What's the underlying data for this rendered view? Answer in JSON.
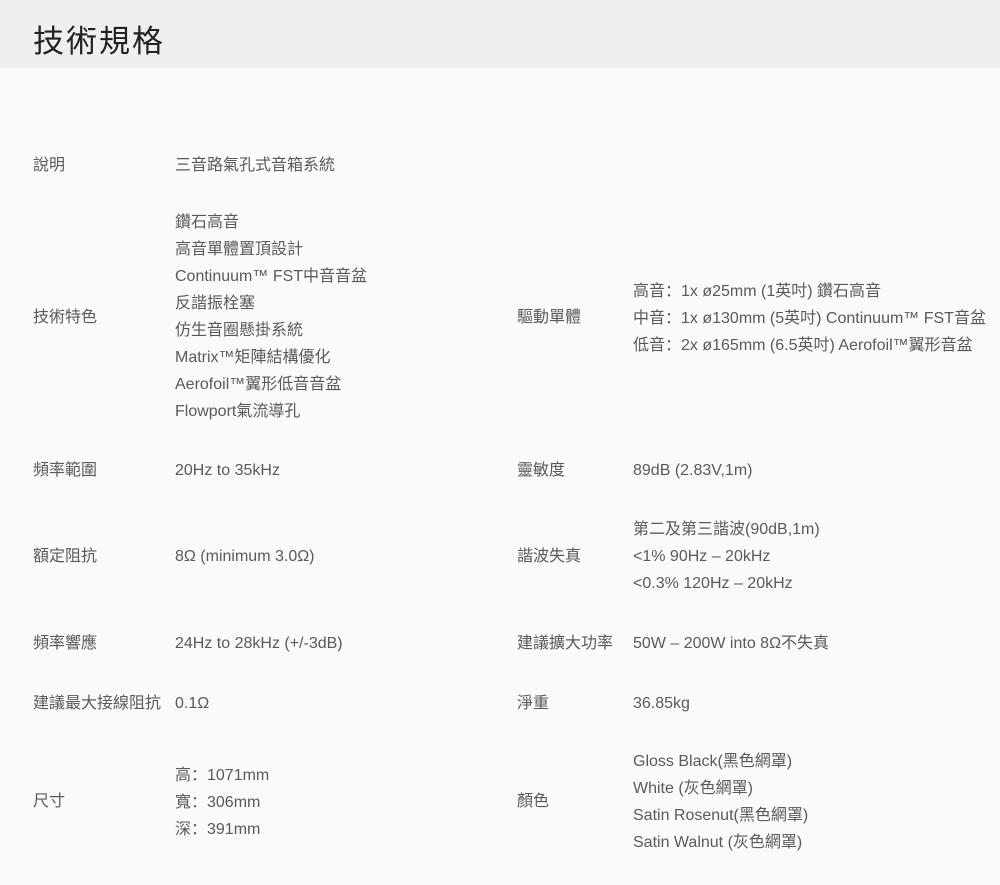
{
  "title": "技術規格",
  "specs": {
    "description": {
      "label": "說明",
      "value": "三音路氣孔式音箱系統"
    },
    "features": {
      "label": "技術特色",
      "lines": [
        "鑽石高音",
        "高音單體置頂設計",
        "Continuum™ FST中音音盆",
        "反諧振栓塞",
        "仿生音圈懸掛系統",
        "Matrix™矩陣結構優化",
        "Aerofoil™翼形低音音盆",
        "Flowport氣流導孔"
      ]
    },
    "drivers": {
      "label": "驅動單體",
      "lines": [
        "高音：1x ø25mm (1英吋) 鑽石高音",
        "中音：1x ø130mm (5英吋) Continuum™ FST音盆",
        "低音：2x ø165mm (6.5英吋) Aerofoil™翼形音盆"
      ]
    },
    "frequency_range": {
      "label": "頻率範圍",
      "value": "20Hz to 35kHz"
    },
    "sensitivity": {
      "label": "靈敏度",
      "value": "89dB (2.83V,1m)"
    },
    "impedance": {
      "label": "額定阻抗",
      "value": "8Ω (minimum 3.0Ω)"
    },
    "distortion": {
      "label": "諧波失真",
      "lines": [
        "第二及第三諧波(90dB,1m)",
        "<1% 90Hz – 20kHz",
        "<0.3% 120Hz – 20kHz"
      ]
    },
    "frequency_response": {
      "label": "頻率響應",
      "value": "24Hz to 28kHz (+/-3dB)"
    },
    "amp_power": {
      "label": "建議擴大功率",
      "value": "50W – 200W into 8Ω不失真"
    },
    "cable_impedance": {
      "label": "建議最大接線阻抗",
      "value": "0.1Ω"
    },
    "weight": {
      "label": "淨重",
      "value": "36.85kg"
    },
    "dimensions": {
      "label": "尺寸",
      "lines": [
        "高：1071mm",
        "寬：306mm",
        "深：391mm"
      ]
    },
    "colors": {
      "label": "顏色",
      "lines": [
        "Gloss Black(黑色網罩)",
        "White (灰色網罩)",
        "Satin Rosenut(黑色網罩)",
        "Satin Walnut (灰色網罩)"
      ]
    }
  }
}
